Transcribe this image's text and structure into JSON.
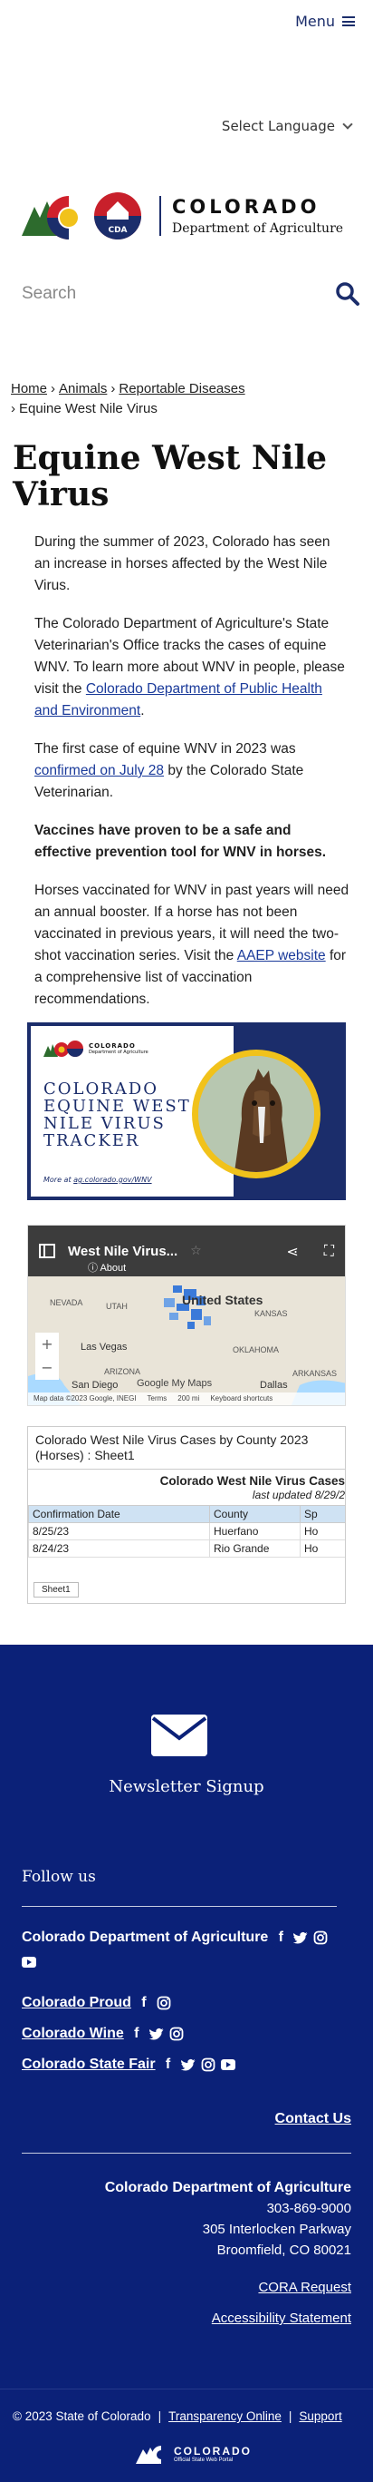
{
  "header": {
    "menu_label": "Menu",
    "language_label": "Select Language",
    "logo_name": "COLORADO",
    "logo_dept": "Department of Agriculture",
    "logo_badge": "CDA",
    "search_placeholder": "Search"
  },
  "breadcrumb": {
    "items": [
      "Home",
      "Animals",
      "Reportable Diseases"
    ],
    "current": "Equine West Nile Virus"
  },
  "page": {
    "title": "Equine West Nile Virus",
    "p1": "During the summer of 2023, Colorado has seen an increase in horses affected by the West Nile Virus.",
    "p2_a": "The Colorado Department of Agriculture's State Veterinarian's Office tracks the cases of equine WNV. To learn more about WNV in people, please visit the ",
    "p2_link": "Colorado Department of Public Health and Environment",
    "p2_b": ".",
    "p3_a": "The first case of equine WNV in 2023 was ",
    "p3_link": "confirmed on July 28",
    "p3_b": " by the Colorado State Veterinarian.",
    "p4": "Vaccines have proven to be a safe and effective prevention tool for WNV in horses.",
    "p5_a": "Horses vaccinated for WNV in past years will need an annual booster. If a horse has not been vaccinated in previous years, it will need the two-shot vaccination series. Visit the ",
    "p5_link": "AAEP website",
    "p5_b": " for a comprehensive list of vaccination recommendations."
  },
  "banner": {
    "title_lines": [
      "COLORADO",
      "EQUINE WEST",
      "NILE VIRUS",
      "TRACKER"
    ],
    "more_prefix": "More at ",
    "more_link": "ag.colorado.gov/WNV",
    "logo_name": "COLORADO",
    "logo_dept": "Department of Agriculture"
  },
  "map": {
    "title": "West Nile Virus...",
    "about": "About",
    "labels": {
      "nevada": "NEVADA",
      "utah": "UTAH",
      "kansas": "KANSAS",
      "las_vegas": "Las Vegas",
      "oklahoma": "OKLAHOMA",
      "arizona": "ARIZONA",
      "arkansas": "ARKANSAS",
      "san_diego": "San Diego",
      "dallas": "Dallas",
      "united_states": "United States"
    },
    "footer": {
      "data": "Map data ©2023 Google, INEGI",
      "terms": "Terms",
      "scale": "200 mi",
      "shortcuts": "Keyboard shortcuts",
      "google": "Google My Maps"
    }
  },
  "sheet": {
    "header": "Colorado West Nile Virus Cases by County 2023 (Horses) : Sheet1",
    "title": "Colorado West Nile Virus Cases",
    "updated": "last updated 8/29/2",
    "columns": [
      "Confirmation Date",
      "County",
      "Sp"
    ],
    "rows": [
      [
        "8/25/23",
        "Huerfano",
        "Ho"
      ],
      [
        "8/24/23",
        "Rio Grande",
        "Ho"
      ]
    ],
    "tab": "Sheet1"
  },
  "footer": {
    "newsletter": "Newsletter Signup",
    "follow": "Follow us",
    "social": [
      {
        "name": "Colorado Department of Agriculture"
      },
      {
        "name": "Colorado Proud"
      },
      {
        "name": "Colorado Wine"
      },
      {
        "name": "Colorado State Fair"
      }
    ],
    "contact": "Contact Us",
    "org": "Colorado Department of Agriculture",
    "phone": "303-869-9000",
    "street": "305 Interlocken Parkway",
    "city": "Broomfield, CO 80021",
    "cora": "CORA Request",
    "access": "Accessibility Statement"
  },
  "bottom": {
    "copyright": "© 2023 State of Colorado",
    "transparency": "Transparency Online",
    "support": "Support",
    "state_name": "COLORADO",
    "state_sub": "Official State Web Portal"
  },
  "colors": {
    "brand_navy": "#0b2178",
    "link": "#1a3a9a",
    "banner_yellow": "#f1c21b"
  }
}
